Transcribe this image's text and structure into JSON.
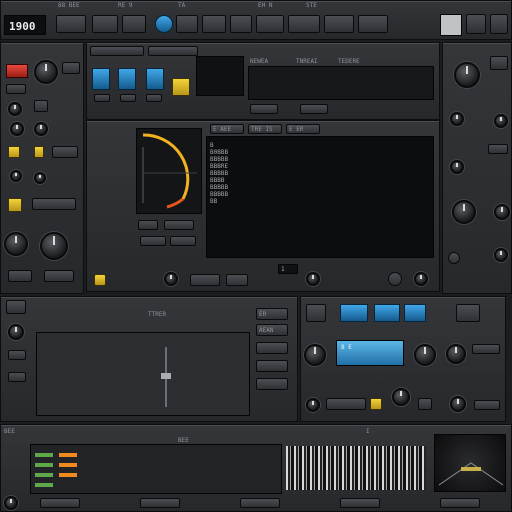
{
  "top_bar": {
    "display_value": "1900",
    "labels": [
      "88 BEE",
      "",
      "RE 9",
      "TA",
      "EH N",
      "STE",
      "",
      "B",
      "8 B",
      "B"
    ]
  },
  "top_right": {
    "labels": [
      "",
      "",
      ""
    ]
  },
  "editor": {
    "column_labels": [
      "NEWEA",
      "TNREAI",
      "TEDERE"
    ],
    "tab_labels": [
      "E AEE",
      "TRE IS",
      "E ER"
    ],
    "rows": [
      "B",
      "B0BBB",
      "BBBBB",
      "BBBRE",
      "BBBBB",
      "BBBB",
      "BBBBB",
      "BBBBB",
      "BB"
    ]
  },
  "transport": {
    "readout": "1"
  },
  "mixer": {
    "channel_label": "TTRER",
    "buttons": [
      "ER",
      "AEAN"
    ]
  },
  "fx_panel": {
    "display_label": "8 E",
    "labels": [
      "E",
      "E",
      "E"
    ]
  },
  "bottom": {
    "labels": [
      "BEE",
      "BEE",
      "I"
    ]
  },
  "colors": {
    "accent_yellow": "#f4d43a",
    "accent_blue": "#3fa8e8",
    "accent_red": "#e64a3c",
    "accent_orange": "#f08a1e",
    "panel": "#2e3034"
  }
}
